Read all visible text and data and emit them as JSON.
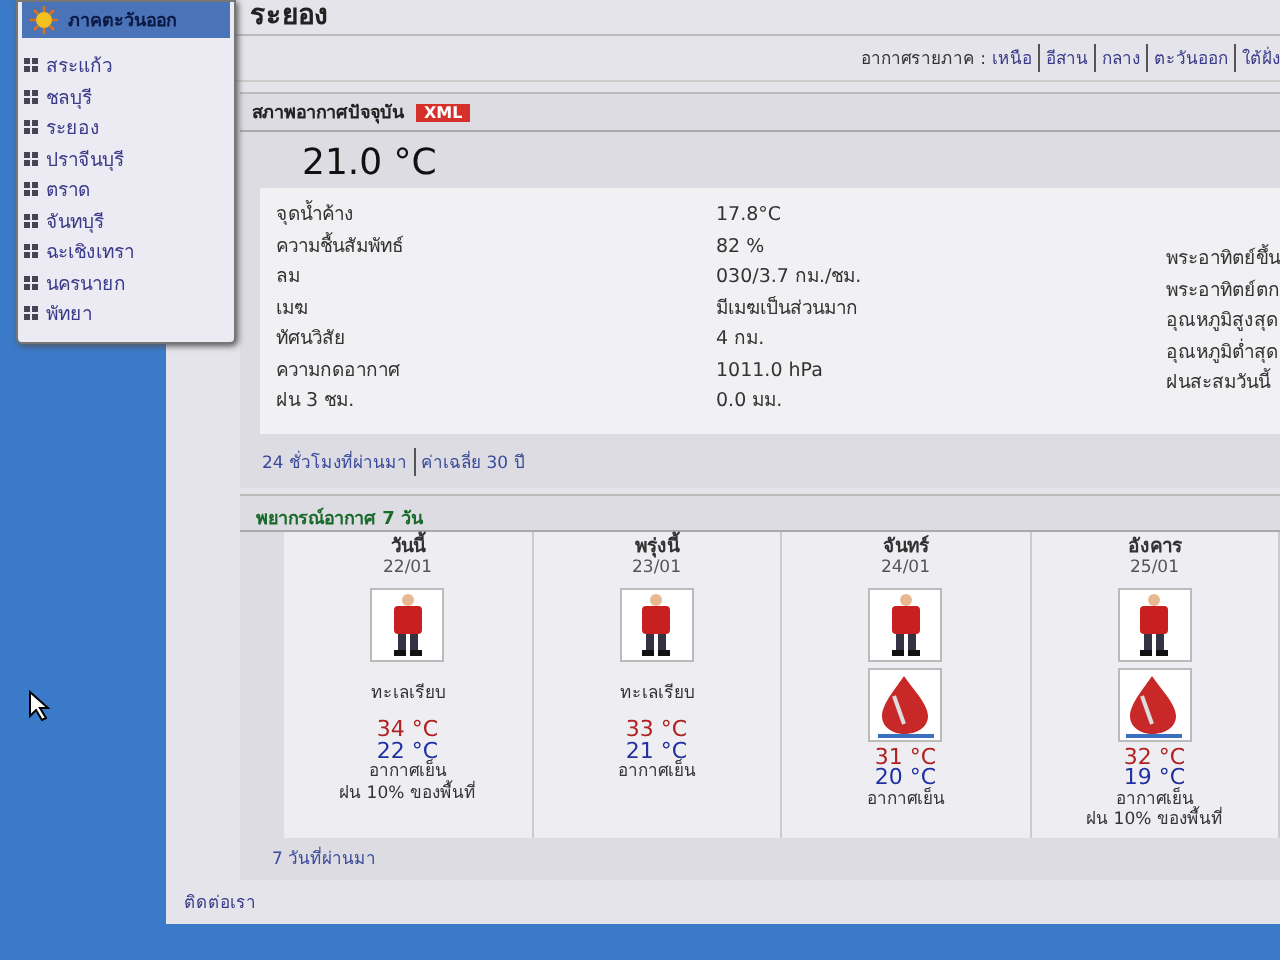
{
  "menu": {
    "title": "ภาคตะวันออก",
    "items": [
      "สระแก้ว",
      "ชลบุรี",
      "ระยอง",
      "ปราจีนบุรี",
      "ตราด",
      "จันทบุรี",
      "ฉะเชิงเทรา",
      "นครนายก",
      "พัทยา"
    ]
  },
  "page_title": "ระยอง",
  "region_links": {
    "label": "อากาศรายภาค :",
    "links": [
      "เหนือ",
      "อีสาน",
      "กลาง",
      "ตะวันออก",
      "ใต้ฝั่ง"
    ]
  },
  "current": {
    "title": "สภาพอากาศปัจจุบัน",
    "badge": "XML",
    "temperature": "21.0 °C",
    "rows": [
      {
        "label": "จุดน้ำค้าง",
        "value": "17.8°C"
      },
      {
        "label": "ความชื้นสัมพัทธ์",
        "value": "82 %"
      },
      {
        "label": "ลม",
        "value": "030/3.7 กม./ชม."
      },
      {
        "label": "เมฆ",
        "value": "มีเมฆเป็นส่วนมาก"
      },
      {
        "label": "ทัศนวิสัย",
        "value": "4 กม."
      },
      {
        "label": "ความกดอากาศ",
        "value": "1011.0 hPa"
      },
      {
        "label": "ฝน 3 ชม.",
        "value": "0.0 มม."
      }
    ],
    "side_labels": [
      "พระอาทิตย์ขึ้น",
      "พระอาทิตย์ตก",
      "อุณหภูมิสูงสุด",
      "อุณหภูมิต่ำสุด",
      "ฝนสะสมวันนี้"
    ],
    "links": [
      "24 ชั่วโมงที่ผ่านมา",
      "ค่าเฉลี่ย 30 ปี"
    ]
  },
  "forecast": {
    "title": "พยากรณ์อากาศ 7 วัน",
    "days": [
      {
        "day": "วันนี้",
        "date": "22/01",
        "icons": [
          {
            "kind": "person"
          }
        ],
        "sea": "ทะเลเรียบ",
        "high": "34 °C",
        "low": "22 °C",
        "desc": "อากาศเย็น",
        "rain": "ฝน 10% ของพื้นที่"
      },
      {
        "day": "พรุ่งนี้",
        "date": "23/01",
        "icons": [
          {
            "kind": "person"
          }
        ],
        "sea": "ทะเลเรียบ",
        "high": "33 °C",
        "low": "21 °C",
        "desc": "อากาศเย็น"
      },
      {
        "day": "จันทร์",
        "date": "24/01",
        "icons": [
          {
            "kind": "person"
          },
          {
            "kind": "rain"
          }
        ],
        "high": "31 °C",
        "low": "20 °C",
        "desc": "อากาศเย็น"
      },
      {
        "day": "อังคาร",
        "date": "25/01",
        "icons": [
          {
            "kind": "person"
          },
          {
            "kind": "rain"
          }
        ],
        "high": "32 °C",
        "low": "19 °C",
        "desc": "อากาศเย็น",
        "rain": "ฝน 10% ของพื้นที่"
      }
    ],
    "link": "7 วันที่ผ่านมา"
  },
  "footer_link": "ติดต่อเรา"
}
